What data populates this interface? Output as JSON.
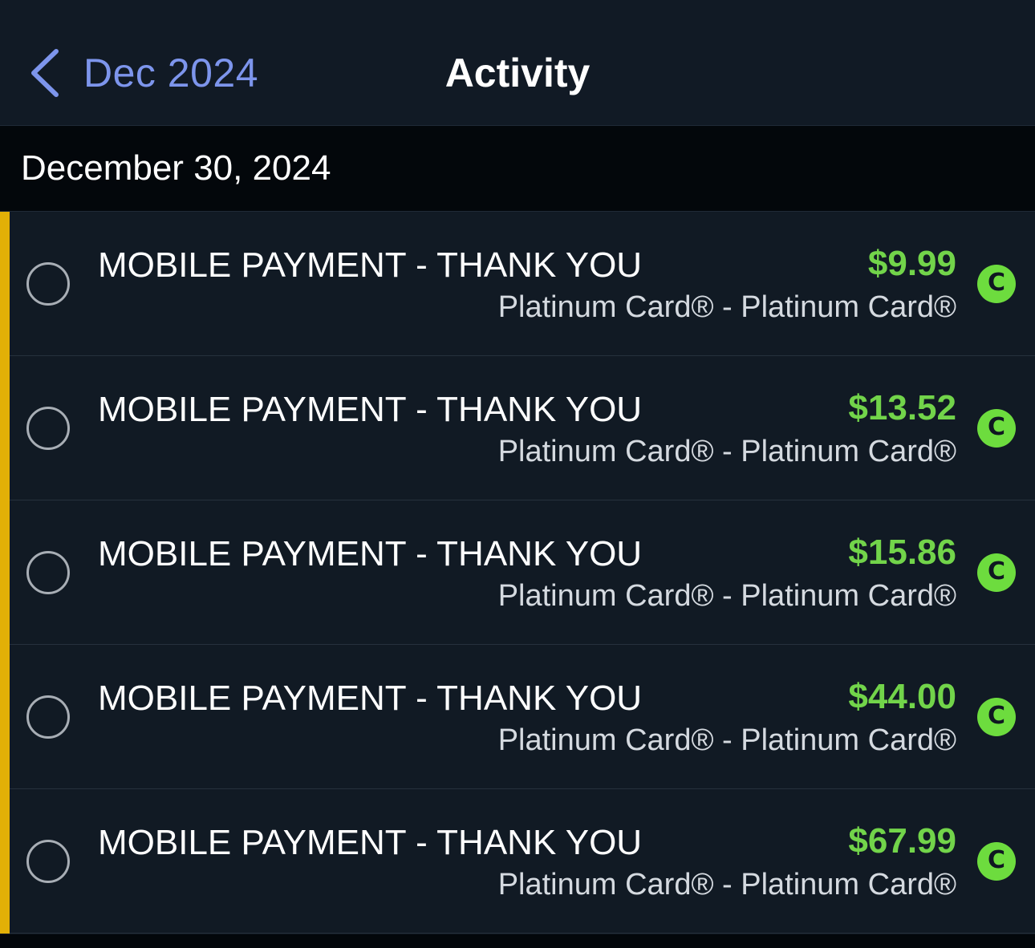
{
  "nav": {
    "back_label": "Dec 2024",
    "title": "Activity"
  },
  "section": {
    "date": "December 30, 2024"
  },
  "colors": {
    "accent": "#7d95ec",
    "amount_positive": "#72d44a",
    "flag": "#e2b007",
    "badge": "#6ddc3e"
  },
  "transactions": [
    {
      "description": "MOBILE PAYMENT - THANK YOU",
      "amount": "$9.99",
      "account": "Platinum Card® - Platinum Card®",
      "status": "C"
    },
    {
      "description": "MOBILE PAYMENT - THANK YOU",
      "amount": "$13.52",
      "account": "Platinum Card® - Platinum Card®",
      "status": "C"
    },
    {
      "description": "MOBILE PAYMENT - THANK YOU",
      "amount": "$15.86",
      "account": "Platinum Card® - Platinum Card®",
      "status": "C"
    },
    {
      "description": "MOBILE PAYMENT - THANK YOU",
      "amount": "$44.00",
      "account": "Platinum Card® - Platinum Card®",
      "status": "C"
    },
    {
      "description": "MOBILE PAYMENT - THANK YOU",
      "amount": "$67.99",
      "account": "Platinum Card® - Platinum Card®",
      "status": "C"
    }
  ]
}
